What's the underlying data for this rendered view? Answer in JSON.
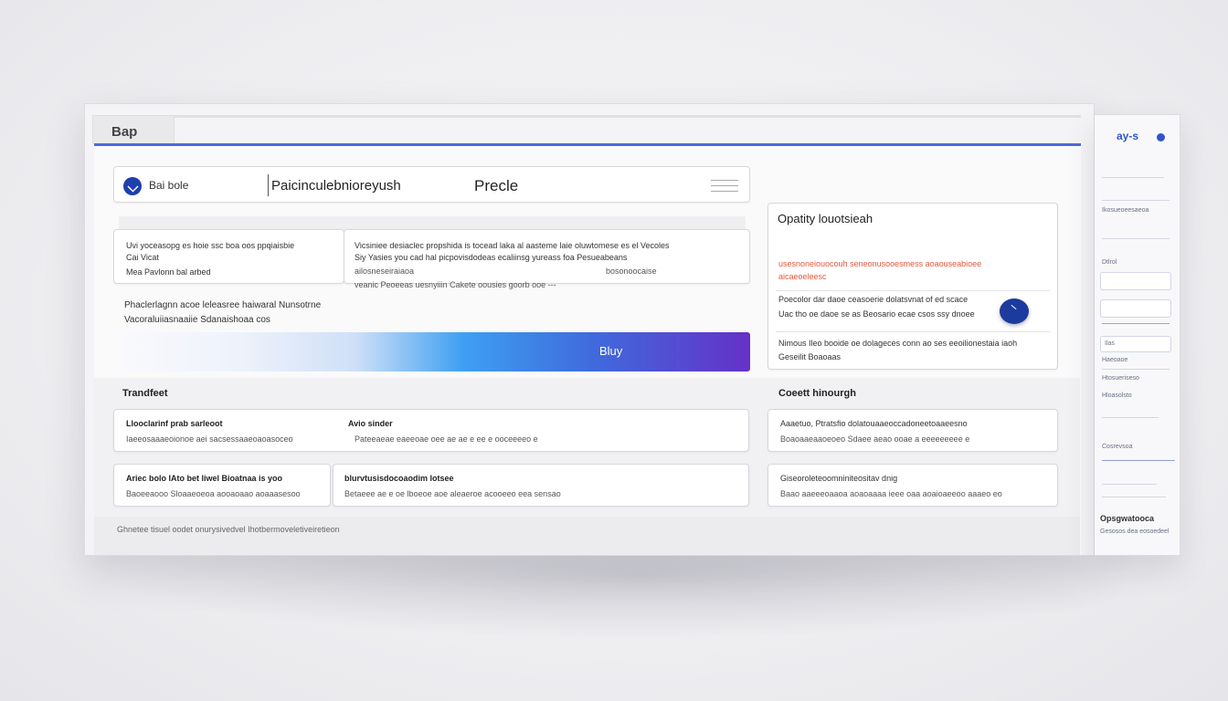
{
  "window": {
    "title": "Bap"
  },
  "search": {
    "brand": "Bai bole",
    "query": "Paicinculebnioreyush",
    "value": "Precle"
  },
  "left_cards": [
    {
      "line1": "Uvi yoceasopg es hoie ssc boa oos ppqiaisbie",
      "line2": "Cai Vicat",
      "line3": "Mea Pavlonn bal arbed"
    },
    {
      "line1": "Vicsiniee desiaclec propshida is tocead laka al aasteme laie oluwtomese es el Vecoles",
      "line2": "Siy Yasies you cad hal picpovisdodeas ecaliinsg yureass foa Pesueabeans",
      "line3": "ailosneseiraiaoa",
      "line3b": "bosonoocaise",
      "line4": "veanic Peoeeas uesnyiiin Cakete oousies goorb ooe ---"
    },
    {
      "line1": "Phaclerlagnn acoe leleasree haiwaral Nunsotrne",
      "line2": "Vacoraluiiasnaaiie Sdanaishoaa cos"
    }
  ],
  "cta": {
    "label": "Bluy"
  },
  "opportunity": {
    "title": "Opatity louotsieah",
    "highlight_1": "usesnoneiouocouh seneonusooesmess aoaouseabioee",
    "highlight_2": "aicaeoeleesc",
    "row_1_a": "Poecolor dar daoe ceasoerie dolatsvnat of ed scace",
    "row_1_b": "Uac tho oe daoe se as Beosario ecae csos ssy dnoee",
    "row_2_a": "Nimous Ileo booide oe dolageces conn ao ses eeoilionestaia iaoh",
    "row_2_b": "Geseilit Boaoaas"
  },
  "transfect": {
    "title": "Trandfeet",
    "cards": [
      {
        "title": "Llooclarinf prab sarleoot",
        "sub": "Iaeeosaaaeoionoe aei sacsessaaeoaoasoceo"
      },
      {
        "title": "Avio sinder",
        "sub": "Pateeaeae eaeeoae oee ae ae e ee e ooceeeeo e"
      },
      {
        "title": "Ariec bolo IAto bet liwel Bioatnaa is yoo",
        "sub": "Baoeeaooo Sloaaeoeoa aooaoaao aoaaasesoo"
      },
      {
        "title": "blurvtusisdocoaodim lotsee",
        "sub": "Betaeee ae e oe lboeoe aoe aleaeroe acooeeo eea sensao"
      }
    ]
  },
  "coeet": {
    "title": "Coeett hinourgh",
    "card_1_title": "Aaaetuo, Ptratsfio dolatouaaeoccadoneetoaaeesno",
    "card_1_sub": "Boaoaaeaaoeoeo Sdaee aeao ooae a eeeeeeeee e",
    "card_2_title": "Giseoroleteoomniniteositav dnig",
    "card_2_sub": "Baao aaeeeoaaoa aoaoaaaa ieee oaa aoaioaeeoo aaaeo eo"
  },
  "footer": {
    "text": "Ghnetee tisuel oodet onurysivedvel Ihotbermoveletiveiretieon"
  },
  "side_panel": {
    "icon_row": "ay-s",
    "items": [
      "Ikosueoeesaeoa",
      "Dtlrol",
      "Haeoaoe",
      "Ilas",
      "Htosueriseso",
      "Hloasolsto",
      "Cosrevsoa"
    ],
    "footer_title": "Opsgwatooca",
    "footer_sub": "Gesosos dea eosoedeel"
  },
  "colors": {
    "accent": "#4d6bd8",
    "primary": "#1f3fae",
    "highlight": "#e2583c",
    "cta_end": "#6531c7"
  }
}
